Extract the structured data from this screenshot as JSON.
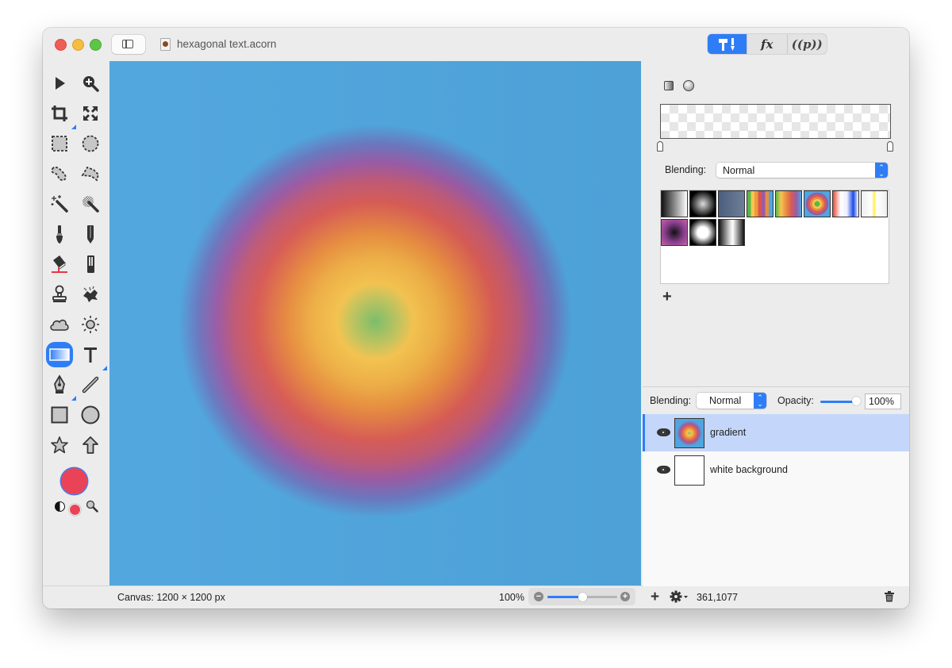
{
  "window": {
    "title": "hexagonal text.acorn",
    "traffic_lights": [
      "close",
      "minimize",
      "zoom"
    ]
  },
  "toolbar": {
    "sidebar_toggle_icon": "sidebar-icon",
    "segments": [
      {
        "name": "tools",
        "label": "",
        "icon": "hammer-brush-icon",
        "active": true
      },
      {
        "name": "filters",
        "label": "fx",
        "active": false
      },
      {
        "name": "properties",
        "label": "((p))",
        "active": false
      }
    ]
  },
  "tools": [
    {
      "name": "select",
      "icon": "arrow-pointer-icon"
    },
    {
      "name": "zoom",
      "icon": "magnifier-plus-icon"
    },
    {
      "name": "crop",
      "icon": "crop-icon",
      "has_submenu": true
    },
    {
      "name": "transform",
      "icon": "expand-arrows-icon"
    },
    {
      "name": "rect-select",
      "icon": "rect-marquee-icon"
    },
    {
      "name": "ellipse-select",
      "icon": "ellipse-marquee-icon"
    },
    {
      "name": "lasso",
      "icon": "lasso-icon"
    },
    {
      "name": "polygon-lasso",
      "icon": "polygon-lasso-icon"
    },
    {
      "name": "magic-wand",
      "icon": "magic-wand-icon"
    },
    {
      "name": "color-wand",
      "icon": "color-wand-icon"
    },
    {
      "name": "brush",
      "icon": "brush-icon"
    },
    {
      "name": "pencil",
      "icon": "pencil-icon"
    },
    {
      "name": "paint-bucket",
      "icon": "paint-bucket-icon"
    },
    {
      "name": "eraser",
      "icon": "eraser-icon"
    },
    {
      "name": "clone-stamp",
      "icon": "stamp-icon"
    },
    {
      "name": "smudge",
      "icon": "smudge-icon"
    },
    {
      "name": "burn",
      "icon": "cloud-icon"
    },
    {
      "name": "dodge",
      "icon": "sun-icon"
    },
    {
      "name": "gradient",
      "icon": "gradient-icon",
      "active": true
    },
    {
      "name": "text",
      "icon": "text-icon",
      "has_submenu": true
    },
    {
      "name": "pen",
      "icon": "pen-nib-icon",
      "has_submenu": true
    },
    {
      "name": "line",
      "icon": "line-icon"
    },
    {
      "name": "rectangle",
      "icon": "rectangle-icon"
    },
    {
      "name": "oval",
      "icon": "oval-icon"
    },
    {
      "name": "star",
      "icon": "star-icon"
    },
    {
      "name": "arrow",
      "icon": "arrow-up-icon"
    }
  ],
  "colors": {
    "foreground": "#ea4357",
    "background_small": "#ea4357",
    "accent": "#2f7df6"
  },
  "canvas": {
    "gradient_stops": [
      "#7cc06b",
      "#f6c550",
      "#e98e40",
      "#d95c55",
      "#9a5ba6",
      "#4fa6de"
    ]
  },
  "status": {
    "canvas_size": "Canvas: 1200 × 1200 px",
    "zoom_label": "100%",
    "zoom_fraction": 0.5
  },
  "gradient_editor": {
    "type_icons": [
      "linear-gradient-icon",
      "radial-gradient-icon"
    ],
    "blending_label": "Blending:",
    "blending_value": "Normal",
    "presets": [
      {
        "name": "black-white-linear",
        "bg": "linear-gradient(90deg,#111,#fff)"
      },
      {
        "name": "radial-white-black",
        "bg": "radial-gradient(circle,#ddd,#000 75%)"
      },
      {
        "name": "slate",
        "bg": "linear-gradient(90deg,#4b5e7d,#6e7f98)"
      },
      {
        "name": "rainbow-stripes",
        "bg": "linear-gradient(90deg,#58b848 0 14%,#f6c550 14% 28%,#ee9b3c 28% 42%,#d9544e 42% 56%,#9a5ba6 56% 70%,#e98e40 70% 84%,#4fa6de 84%)"
      },
      {
        "name": "rainbow-smooth",
        "bg": "linear-gradient(90deg,#58b848,#f6c550,#e98e40,#d95c55,#9a5ba6,#4fa6de)"
      },
      {
        "name": "rainbow-radial",
        "bg": "radial-gradient(circle,#58b848 0 15%,#f6c550 15% 27%,#e98e40 27% 39%,#d95c55 39% 51%,#9a5ba6 51% 63%,#4fa6de 63%)"
      },
      {
        "name": "red-white-blue",
        "bg": "linear-gradient(90deg,#e94c3a,#fff 30%,#eef 55%,#1a4be8 80%,#fff)"
      },
      {
        "name": "yellow-transparent",
        "bg": "linear-gradient(90deg,#eee,#fff 40%,#ffee55 50%,#fff 60%,#eee)"
      },
      {
        "name": "purple-radial",
        "bg": "radial-gradient(circle,#111,#8a3f8f 55%,#c263a4)"
      },
      {
        "name": "white-glow",
        "bg": "radial-gradient(circle,#fff 30%,#000 80%)"
      },
      {
        "name": "silver-bars",
        "bg": "linear-gradient(90deg,#111,#ddd 45%,#fff 55%,#111)"
      }
    ],
    "add_label": "+"
  },
  "layers_panel": {
    "blending_label": "Blending:",
    "blending_value": "Normal",
    "opacity_label": "Opacity:",
    "opacity_value": "100%",
    "opacity_fraction": 1.0,
    "layers": [
      {
        "name": "gradient",
        "visible": true,
        "selected": true
      },
      {
        "name": "white background",
        "visible": true,
        "selected": false
      }
    ]
  },
  "bottom_right": {
    "add_label": "+",
    "coordinates": "361,1077"
  }
}
